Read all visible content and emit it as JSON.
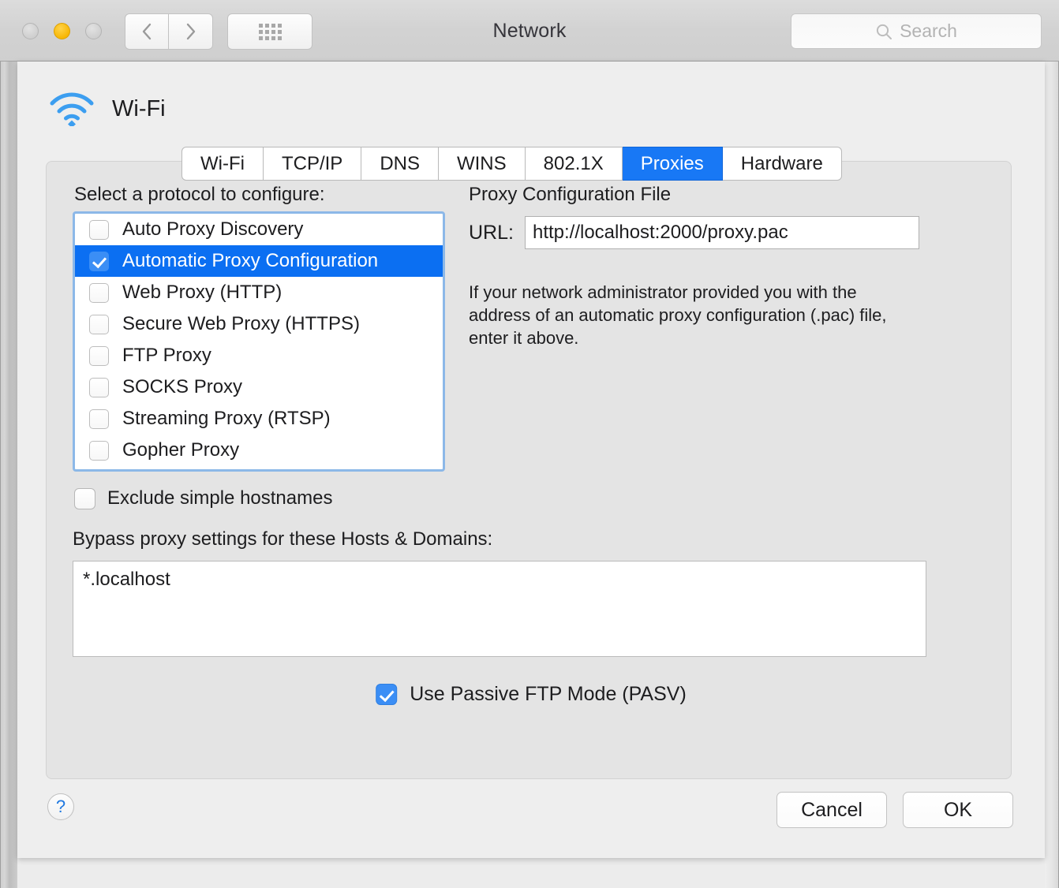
{
  "window": {
    "title": "Network",
    "traffic_lights": [
      "close-button",
      "minimize-button",
      "zoom-button"
    ],
    "nav": {
      "back_icon": "chevron-left-icon",
      "forward_icon": "chevron-right-icon",
      "grid_icon": "show-all-grid-icon"
    },
    "search": {
      "placeholder": "Search",
      "value": "",
      "icon": "search-icon"
    }
  },
  "interface": {
    "icon": "wifi-icon",
    "name": "Wi-Fi"
  },
  "tabs": [
    {
      "label": "Wi-Fi",
      "active": false
    },
    {
      "label": "TCP/IP",
      "active": false
    },
    {
      "label": "DNS",
      "active": false
    },
    {
      "label": "WINS",
      "active": false
    },
    {
      "label": "802.1X",
      "active": false
    },
    {
      "label": "Proxies",
      "active": true
    },
    {
      "label": "Hardware",
      "active": false
    }
  ],
  "proxies": {
    "protocol_label": "Select a protocol to configure:",
    "protocols": [
      {
        "label": "Auto Proxy Discovery",
        "checked": false,
        "selected": false
      },
      {
        "label": "Automatic Proxy Configuration",
        "checked": true,
        "selected": true
      },
      {
        "label": "Web Proxy (HTTP)",
        "checked": false,
        "selected": false
      },
      {
        "label": "Secure Web Proxy (HTTPS)",
        "checked": false,
        "selected": false
      },
      {
        "label": "FTP Proxy",
        "checked": false,
        "selected": false
      },
      {
        "label": "SOCKS Proxy",
        "checked": false,
        "selected": false
      },
      {
        "label": "Streaming Proxy (RTSP)",
        "checked": false,
        "selected": false
      },
      {
        "label": "Gopher Proxy",
        "checked": false,
        "selected": false
      }
    ],
    "exclude_simple_hostnames": {
      "label": "Exclude simple hostnames",
      "checked": false
    },
    "bypass_label": "Bypass proxy settings for these Hosts & Domains:",
    "bypass_value": "*.localhost",
    "passive_ftp": {
      "label": "Use Passive FTP Mode (PASV)",
      "checked": true
    },
    "pac": {
      "title": "Proxy Configuration File",
      "url_label": "URL:",
      "url_value": "http://localhost:2000/proxy.pac",
      "help_text": "If your network administrator provided you with the address of an automatic proxy configuration (.pac) file, enter it above."
    }
  },
  "footer": {
    "help_label": "?",
    "cancel_label": "Cancel",
    "ok_label": "OK"
  },
  "colors": {
    "accent_blue": "#1878f5",
    "selection_blue": "#0b6ff2",
    "checkbox_blue": "#3b8ef5",
    "focus_ring": "#8cb8e8",
    "help_blue": "#1f78e0",
    "minimize_yellow": "#f7b500"
  }
}
